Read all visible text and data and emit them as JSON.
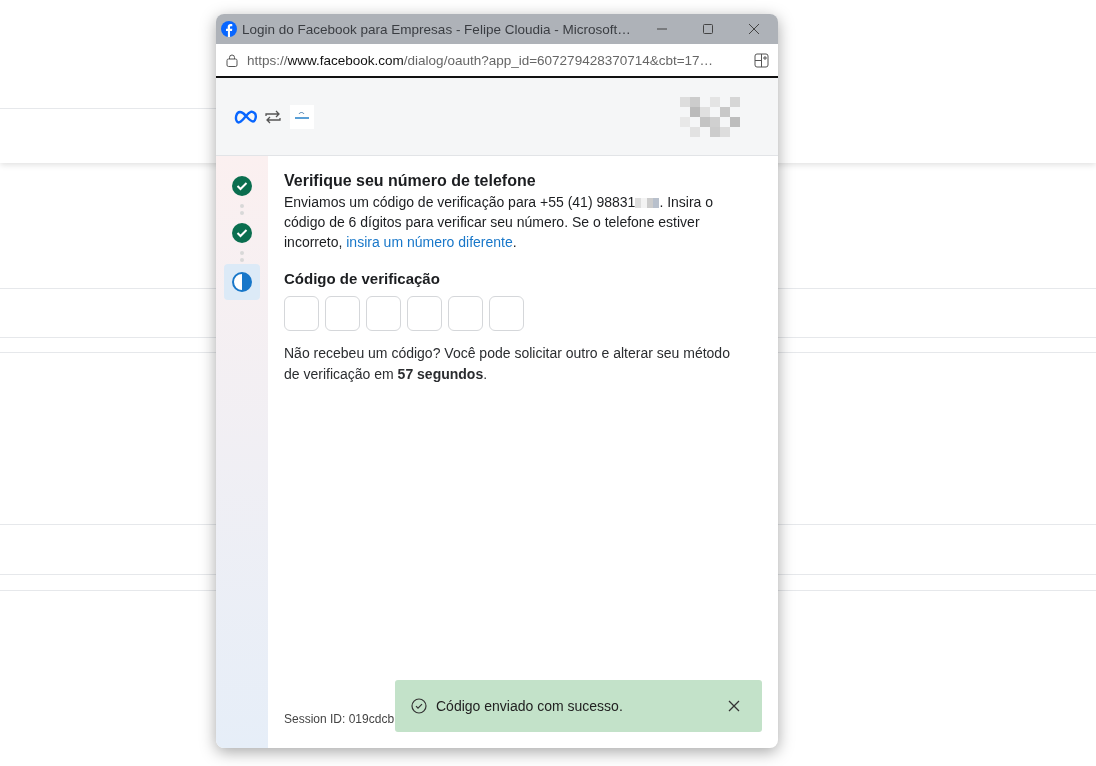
{
  "window": {
    "title": "Login do Facebook para Empresas - Felipe Cloudia - Microsoft…"
  },
  "address_bar": {
    "scheme": "https://",
    "host": "www.facebook.com",
    "path": "/dialog/oauth?app_id=607279428370714&cbt=17…"
  },
  "steps": [
    {
      "kind": "done",
      "selected": false
    },
    {
      "kind": "done",
      "selected": false
    },
    {
      "kind": "current",
      "selected": true
    }
  ],
  "heading": "Verifique seu número de telefone",
  "intro": {
    "before": "Enviamos um código de verificação para +55 (41) 98831",
    "after": ". Insira o código de 6 dígitos para verificar seu número. Se o telefone estiver incorreto, ",
    "link": "insira um número diferente",
    "end": "."
  },
  "code_label": "Código de verificação",
  "code_boxes": [
    {
      "focused": false
    },
    {
      "focused": false
    },
    {
      "focused": false
    },
    {
      "focused": false
    },
    {
      "focused": false
    },
    {
      "focused": false
    }
  ],
  "resend_note": "Não recebeu um código? Você pode solicitar outro e alterar seu método de verificação em **57 segundos**.",
  "session_id": "Session ID: 019cdcb",
  "toast": {
    "message": "Código enviado com sucesso."
  }
}
